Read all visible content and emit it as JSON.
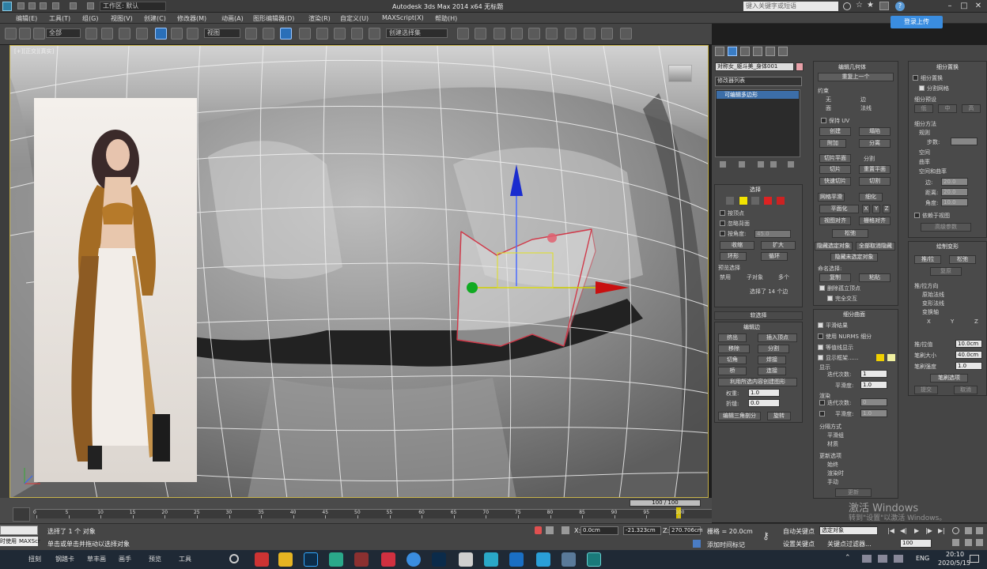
{
  "title": "Autodesk 3ds Max  2014 x64   无标题",
  "workspace": "工作区: 默认",
  "search_placeholder": "键入关键字或短语",
  "login_label": "登录上传",
  "menu": [
    "编辑(E)",
    "工具(T)",
    "组(G)",
    "视图(V)",
    "创建(C)",
    "修改器(M)",
    "动画(A)",
    "图形编辑器(D)",
    "渲染(R)",
    "自定义(U)",
    "MAXScript(X)",
    "帮助(H)"
  ],
  "toolbar": {
    "filter_value": "全部",
    "refcoord_value": "视图",
    "selset_value": "创建选择集"
  },
  "viewport": {
    "label": "[+][正交][真实]",
    "axis_x": "x",
    "axis_y": "y"
  },
  "command_panel": {
    "object_name": "对称女_躯斗美_身体001",
    "modifier_list": "修改器列表",
    "stack_item": "可编辑多边形",
    "selection": {
      "header": "选择",
      "by_vertex": "按顶点",
      "ignore_backfacing": "忽略背面",
      "by_angle": "按角度:",
      "angle_value": "45.0",
      "shrink": "收缩",
      "grow": "扩大",
      "ring": "环形",
      "loop": "循环",
      "preview_selection": "预览选择",
      "preview_off": "禁用",
      "preview_subobj": "子对象",
      "preview_multi": "多个",
      "status": "选择了 14 个边"
    },
    "soft_selection": "软选择",
    "edit_edges": {
      "header": "编辑边",
      "insert_vertex": "插入顶点",
      "remove": "移除",
      "split": "分割",
      "extrude": "挤出",
      "weld": "焊接",
      "chamfer": "切角",
      "target_weld": "目标焊接",
      "bridge": "桥",
      "connect": "连接",
      "create_shape": "利用所选内容创建图形",
      "weight_label": "权重:",
      "weight_value": "1.0",
      "crease_label": "折缝:",
      "crease_value": "0.0",
      "edit_tri": "编辑三角剖分",
      "turn": "旋转"
    },
    "edit_geometry": {
      "header": "编辑几何体",
      "repeat_last": "重复上一个",
      "constraints": "约束",
      "c_none": "无",
      "c_edge": "边",
      "c_face": "面",
      "c_normal": "法线",
      "preserve_uv": "保持 UV",
      "create": "创建",
      "collapse": "塌陷",
      "attach": "附加",
      "detach": "分离",
      "slice_plane": "切片平面",
      "split": "分割",
      "slice": "切片",
      "reset_plane": "重置平面",
      "quickslice": "快速切片",
      "cut": "切割",
      "meshsmooth": "网格平滑",
      "tessellate": "细化",
      "planarize": "平面化",
      "x": "X",
      "y": "Y",
      "z": "Z",
      "view_align": "视图对齐",
      "grid_align": "栅格对齐",
      "relax": "松弛",
      "hide_selected": "隐藏选定对象",
      "unhide_all": "全部取消隐藏",
      "hide_unselected": "隐藏未选定对象",
      "named_sel": "命名选择:",
      "copy": "复制",
      "paste": "粘贴",
      "delete_iso": "删除孤立顶点",
      "full_interactivity": "完全交互"
    },
    "subdivision_surface": {
      "header": "细分曲面",
      "smooth_result": "平滑结果",
      "use_nurms": "使用 NURMS 细分",
      "isoline": "等值线显示",
      "show_cage": "显示框架......",
      "display": "显示",
      "iterations": "迭代次数:",
      "iter_value": "1",
      "smoothness": "平滑度:",
      "smooth_value": "1.0",
      "render": "渲染",
      "r_iterations": "迭代次数:",
      "r_iter_value": "0",
      "r_smoothness": "平滑度:",
      "r_smooth_value": "1.0",
      "separate_by": "分隔方式",
      "smoothing_groups": "平滑组",
      "materials": "材质",
      "update_options": "更新选项",
      "always": "始终",
      "when_rendering": "渲染时",
      "manually": "手动",
      "update": "更新"
    },
    "subdivision_displacement": {
      "header": "细分置换",
      "subdiv_disp": "细分置换",
      "split_mesh": "分割网格",
      "presets": "细分预设",
      "low": "低",
      "medium": "中",
      "high": "高",
      "method": "细分方法",
      "regular": "规则",
      "steps": "步数:",
      "spatial": "空间",
      "curvature": "曲率",
      "spatial_curv": "空间和曲率",
      "edge": "边:",
      "edge_value": "20.0",
      "distance": "距离:",
      "distance_value": "20.0",
      "angle": "角度:",
      "angle_value": "10.0",
      "view_dependent": "依赖于视图",
      "advanced": "高级参数"
    },
    "paint_deform": {
      "header": "绘制变形",
      "push_pull": "推/拉",
      "relax": "松弛",
      "revert": "复原",
      "direction": "推/拉方向",
      "original_normals": "原始法线",
      "deformed_normals": "变形法线",
      "transform_axis": "变换轴",
      "x": "X",
      "y": "Y",
      "z": "Z",
      "push_value_label": "推/拉值",
      "push_value": "10.0cm",
      "brush_size_label": "笔刷大小",
      "brush_size": "40.0cm",
      "brush_strength_label": "笔刷强度",
      "brush_strength": "1.0",
      "brush_options": "笔刷选项",
      "commit": "提交",
      "cancel": "取消"
    }
  },
  "timeline": {
    "frame": "100 / 100",
    "ticks": [
      "0",
      "5",
      "10",
      "15",
      "20",
      "25",
      "30",
      "35",
      "40",
      "45",
      "50",
      "55",
      "60",
      "65",
      "70",
      "75",
      "80",
      "85",
      "90",
      "95",
      "100"
    ]
  },
  "status": {
    "left_tab": "时使用",
    "maxscript": "MAXScr",
    "selected": "选择了 1 个 对象",
    "hint": "单击或单击并拖动以选择对象",
    "x_label": "X:",
    "x_value": "0.0cm",
    "y_value": "-21.323cm",
    "z_label": "Z:",
    "z_value": "270.706cm",
    "grid": "栅格 = 20.0cm",
    "add_time_tag": "添加时间标记",
    "auto_key": "自动关键点",
    "set_key": "设置关键点",
    "sel_obj": "选定对象",
    "key_filters": "关键点过滤器...",
    "frame_value": "100"
  },
  "watermark": {
    "line1": "激活 Windows",
    "line2": "转到\"设置\"以激活 Windows。"
  },
  "taskbar": {
    "tabs": [
      "扭刻",
      "钢踏卡",
      "草丰画",
      "画手",
      "预览",
      "工具"
    ],
    "ime": "ENG",
    "time": "20:10",
    "date": "2020/5/15"
  }
}
